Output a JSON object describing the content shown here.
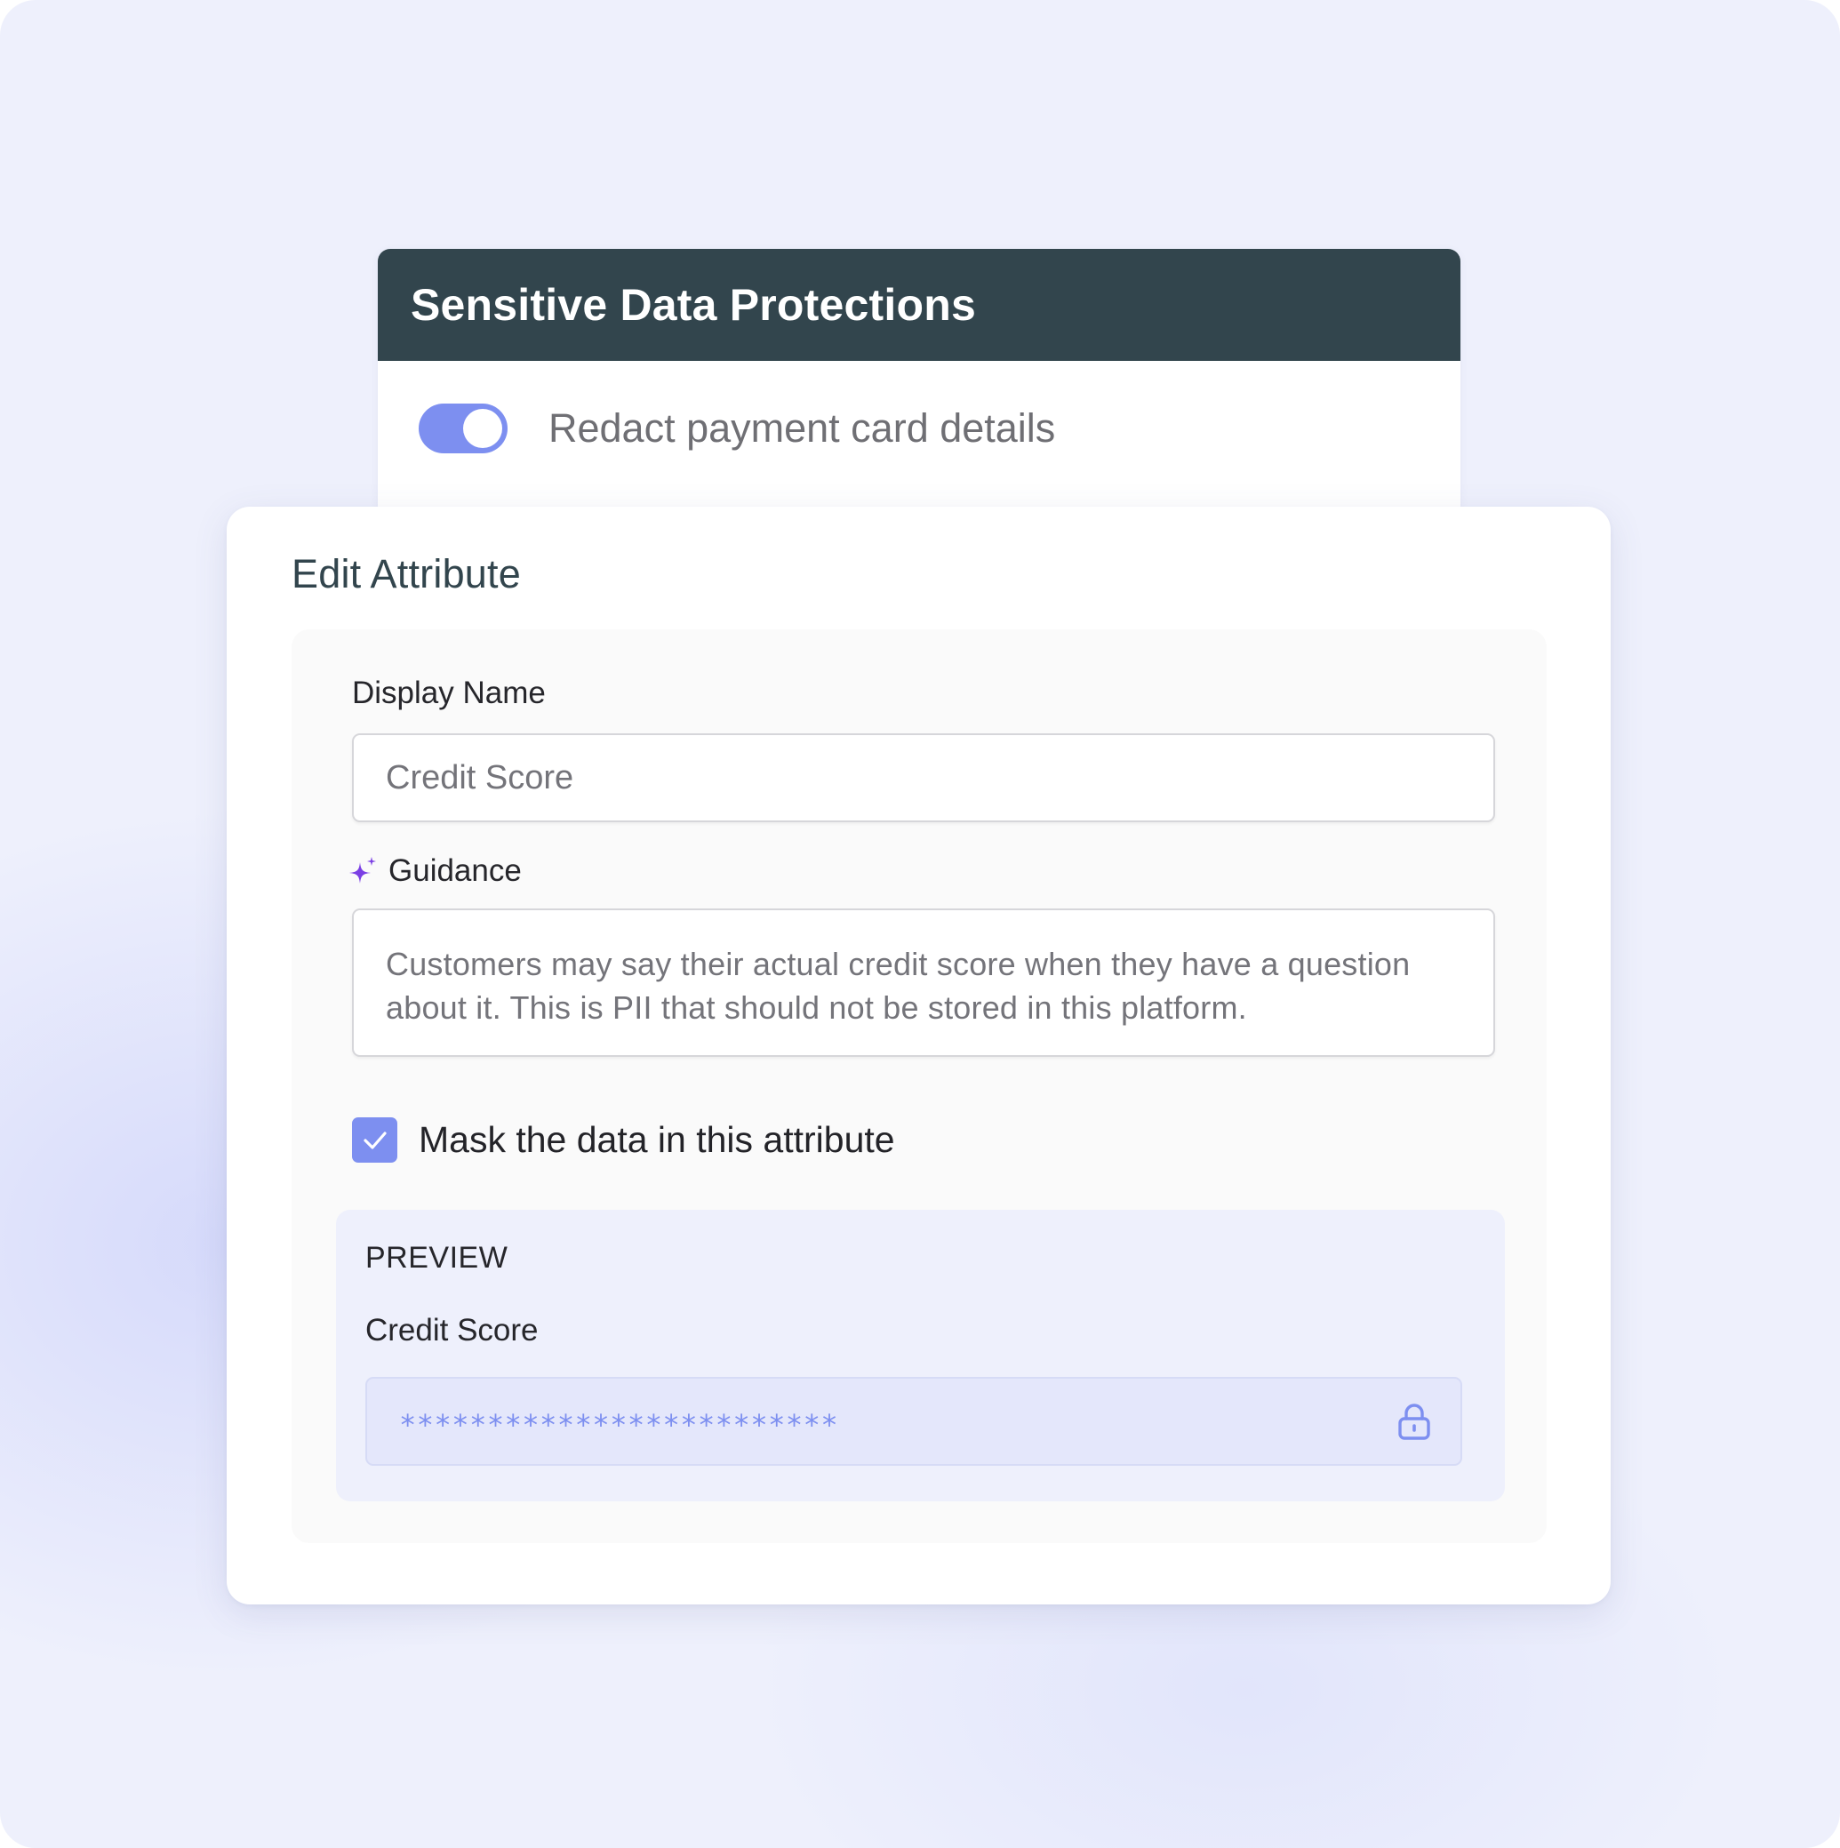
{
  "protections_panel": {
    "title": "Sensitive Data Protections",
    "redact_toggle": {
      "label": "Redact payment card details",
      "enabled": true
    }
  },
  "edit_attribute": {
    "title": "Edit Attribute",
    "display_name": {
      "label": "Display Name",
      "value": "Credit Score"
    },
    "guidance": {
      "label": "Guidance",
      "icon": "sparkle-icon",
      "value": "Customers may say their actual credit score when they have a question about it. This is PII that should not be stored in this platform."
    },
    "mask_checkbox": {
      "label": "Mask the data in this attribute",
      "checked": true
    },
    "preview": {
      "heading": "PREVIEW",
      "field_label": "Credit Score",
      "masked_value": "*************************",
      "icon": "lock-icon"
    }
  },
  "colors": {
    "accent": "#7d8ff0",
    "header_bg": "#32454d",
    "sparkle": "#7b3fe4",
    "page_bg": "#eef0fc",
    "preview_bg": "#eef0fc",
    "masked_input_bg": "#e4e7fb"
  }
}
